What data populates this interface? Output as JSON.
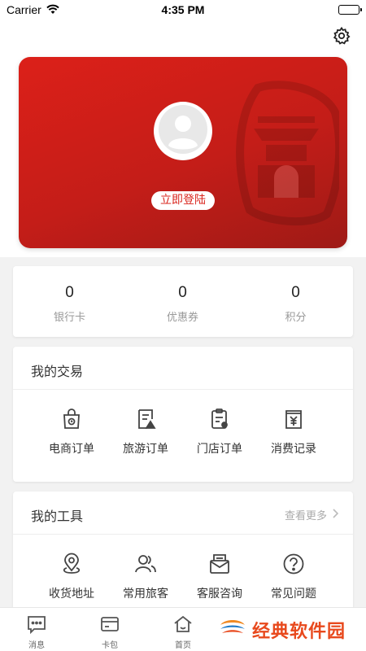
{
  "status_bar": {
    "carrier": "Carrier",
    "time": "4:35 PM"
  },
  "profile": {
    "login_label": "立即登陆"
  },
  "stats": [
    {
      "value": "0",
      "label": "银行卡"
    },
    {
      "value": "0",
      "label": "优惠券"
    },
    {
      "value": "0",
      "label": "积分"
    }
  ],
  "trade": {
    "title": "我的交易",
    "items": [
      {
        "label": "电商订单",
        "icon": "shopping-bag-icon"
      },
      {
        "label": "旅游订单",
        "icon": "travel-document-icon"
      },
      {
        "label": "门店订单",
        "icon": "store-order-icon"
      },
      {
        "label": "消费记录",
        "icon": "yuan-receipt-icon"
      }
    ]
  },
  "tools": {
    "title": "我的工具",
    "more_label": "查看更多",
    "items": [
      {
        "label": "收货地址",
        "icon": "location-pin-icon"
      },
      {
        "label": "常用旅客",
        "icon": "users-icon"
      },
      {
        "label": "客服咨询",
        "icon": "mail-icon"
      },
      {
        "label": "常见问题",
        "icon": "question-icon"
      }
    ]
  },
  "tab_bar": {
    "tabs": [
      {
        "label": "消息",
        "icon": "message-icon"
      },
      {
        "label": "卡包",
        "icon": "card-wallet-icon"
      },
      {
        "label": "首页",
        "icon": "home-icon"
      }
    ]
  },
  "watermark": {
    "text": "经典软件园"
  },
  "colors": {
    "accent": "#d9241c",
    "background": "#f2f2f2",
    "card": "#ffffff",
    "muted": "#999999"
  }
}
